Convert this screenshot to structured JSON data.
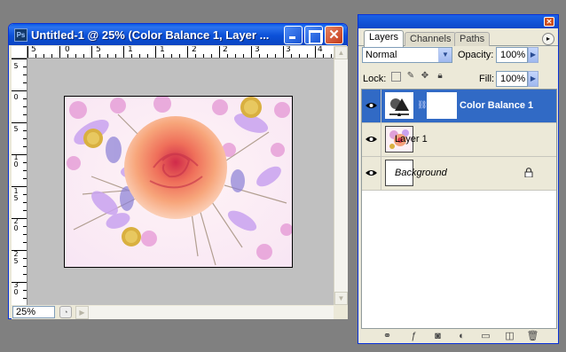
{
  "document": {
    "title": "Untitled-1 @ 25% (Color Balance 1, Layer ...",
    "zoom": "25%",
    "ruler_h_labels": [
      "5",
      "0",
      "5",
      "1",
      "1",
      "2",
      "2",
      "3",
      "3",
      "4"
    ],
    "ruler_v_labels": [
      "5",
      "0",
      "5",
      "1 0",
      "1 5",
      "2 0",
      "2 5",
      "3 0"
    ]
  },
  "layers_panel": {
    "tabs": [
      {
        "label": "Layers",
        "active": true
      },
      {
        "label": "Channels",
        "active": false
      },
      {
        "label": "Paths",
        "active": false
      }
    ],
    "blend_mode": "Normal",
    "opacity_label": "Opacity:",
    "opacity_value": "100%",
    "lock_label": "Lock:",
    "fill_label": "Fill:",
    "fill_value": "100%",
    "layers": [
      {
        "name": "Color Balance 1",
        "selected": true,
        "visible": true
      },
      {
        "name": "Layer 1",
        "selected": false,
        "visible": true
      },
      {
        "name": "Background",
        "selected": false,
        "visible": true,
        "locked": true
      }
    ]
  },
  "colors": {
    "xp_blue": "#0a5ce6",
    "selection": "#316ac5",
    "panel_bg": "#ece9d8"
  }
}
